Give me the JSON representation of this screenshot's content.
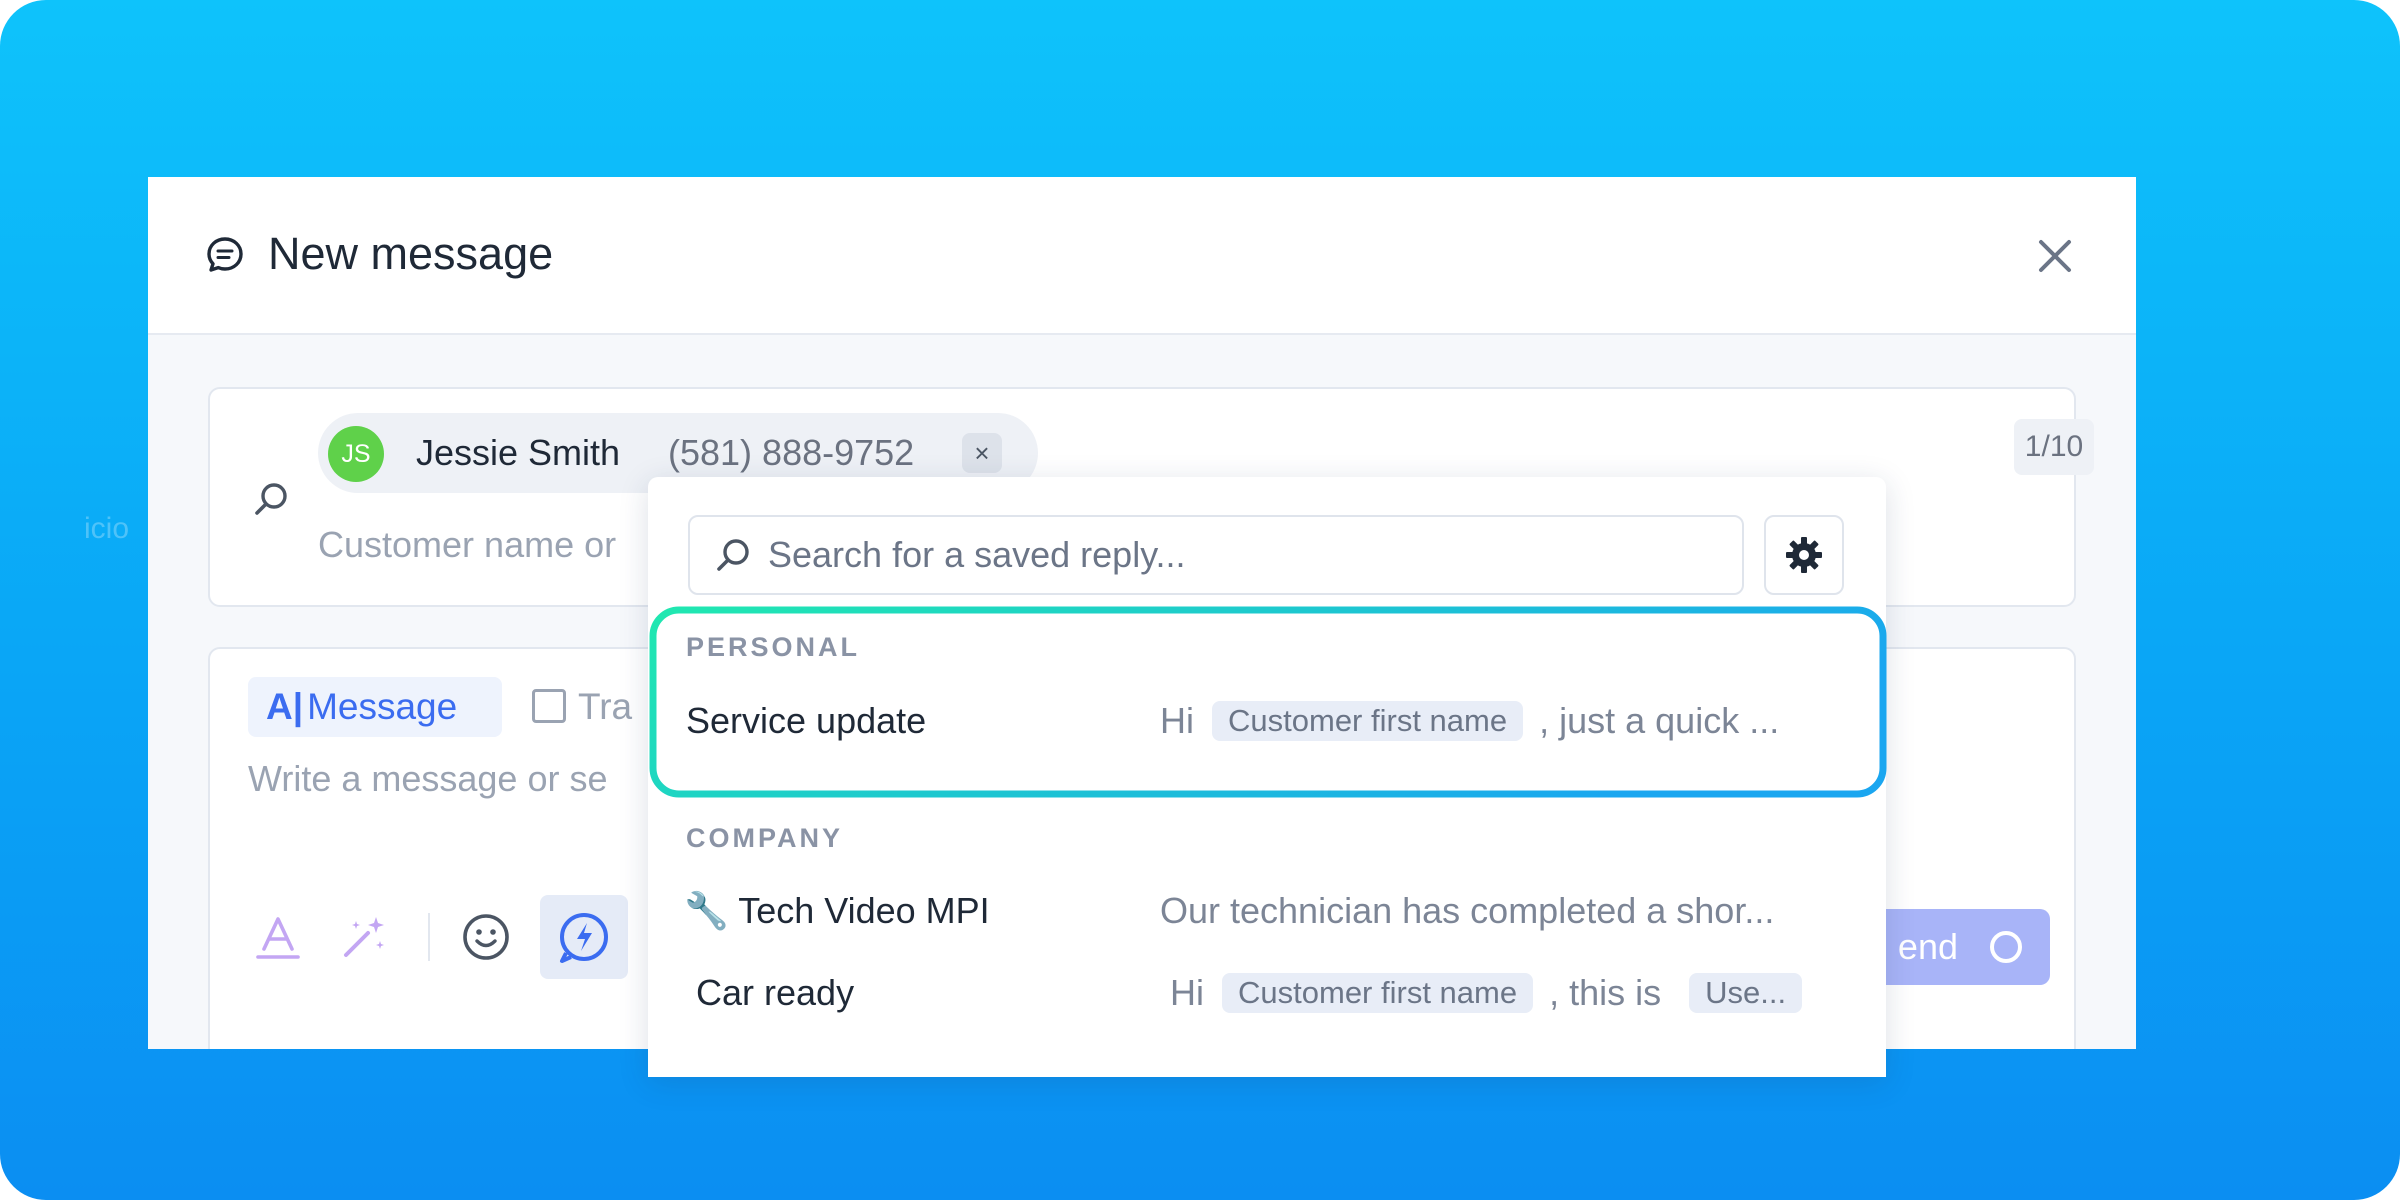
{
  "colors": {
    "background_top": "#0ec3fb",
    "background_bottom": "#0b8ef2",
    "accent": "#3b6cf0",
    "highlight_start": "#20e8b0",
    "highlight_end": "#1aa6f0",
    "avatar": "#5fd14a"
  },
  "background_fragment": "icio",
  "modal": {
    "title": "New message",
    "title_icon": "chat-bubble-icon",
    "close_icon": "close-icon"
  },
  "recipient": {
    "initials": "JS",
    "name": "Jessie Smith",
    "phone": "(581) 888-9752",
    "remove_label": "×",
    "counter": "1/10",
    "input_placeholder": "Customer name or"
  },
  "composer": {
    "tab_message": "Message",
    "tab_second": "Tra",
    "placeholder": "Write a message or se",
    "send_label": "end",
    "toolbar_icons": [
      "text-format-icon",
      "magic-wand-icon",
      "emoji-icon",
      "quick-reply-icon"
    ]
  },
  "saved_replies": {
    "search_placeholder": "Search for a saved reply...",
    "settings_icon": "gear-icon",
    "sections": [
      {
        "label": "PERSONAL",
        "items": [
          {
            "title": "Service update",
            "preview_prefix": "Hi",
            "preview_tag": "Customer first name",
            "preview_suffix": ", just a quick ..."
          }
        ]
      },
      {
        "label": "COMPANY",
        "items": [
          {
            "icon": "🔧",
            "title": "Tech Video MPI",
            "preview_text": "Our technician has completed a shor..."
          },
          {
            "title": "Car ready",
            "preview_prefix": "Hi",
            "preview_tag": "Customer first name",
            "preview_mid": ", this is",
            "preview_tag2": "Use..."
          }
        ]
      }
    ]
  }
}
